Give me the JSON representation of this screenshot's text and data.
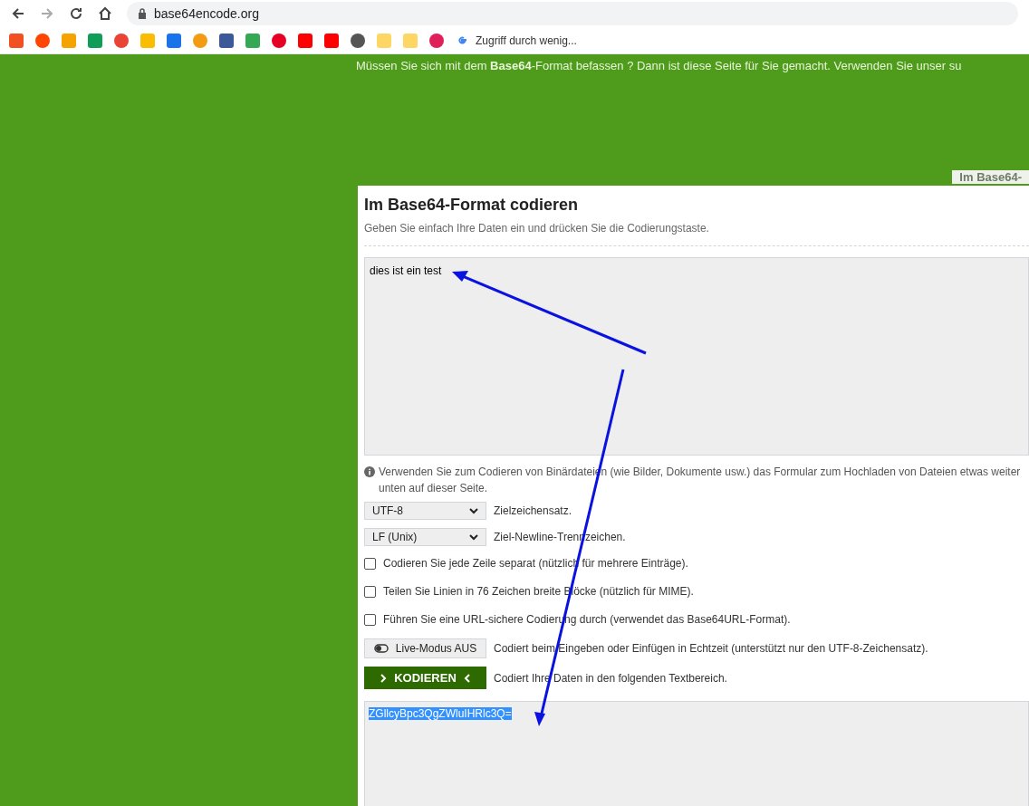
{
  "browser": {
    "url": "base64encode.org",
    "bookmarks": [
      {
        "color": "#f25022"
      },
      {
        "color": "#ff4500"
      },
      {
        "color": "#f4a300"
      },
      {
        "color": "#0f9d58"
      },
      {
        "color": "#ea4335"
      },
      {
        "color": "#fbbc04"
      },
      {
        "color": "#1a73e8"
      },
      {
        "color": "#f39c12"
      },
      {
        "color": "#3b5998"
      },
      {
        "color": "#34a853"
      },
      {
        "color": "#e60023"
      },
      {
        "color": "#ff0000"
      },
      {
        "color": "#ff0000"
      },
      {
        "color": "#555555"
      },
      {
        "color": "#fdd663"
      },
      {
        "color": "#fdd663"
      },
      {
        "color": "#e01e5a"
      }
    ],
    "bookmark_label": "Zugriff durch wenig..."
  },
  "header_text": "Müssen Sie sich mit dem **Base64**-Format befassen ? Dann ist diese Seite für Sie gemacht. Verwenden Sie unser su",
  "side_tab": "Im Base64-",
  "panel": {
    "title": "Im Base64-Format codieren",
    "subtitle": "Geben Sie einfach Ihre Daten ein und drücken Sie die Codierungstaste.",
    "input_value": "dies ist ein test",
    "info": "Verwenden Sie zum Codieren von Binärdateien (wie Bilder, Dokumente usw.) das Formular zum Hochladen von Dateien etwas weiter unten auf dieser Seite.",
    "selects": [
      {
        "value": "UTF-8",
        "label": "Zielzeichensatz."
      },
      {
        "value": "LF (Unix)",
        "label": "Ziel-Newline-Trennzeichen."
      }
    ],
    "options": [
      {
        "label": "Codieren Sie jede Zeile separat (nützlich für mehrere Einträge).",
        "checked": false
      },
      {
        "label": "Teilen Sie Linien in 76 Zeichen breite Blöcke (nützlich für MIME).",
        "checked": false
      },
      {
        "label": "Führen Sie eine URL-sichere Codierung durch (verwendet das Base64URL-Format).",
        "checked": false
      }
    ],
    "live_button": "Live-Modus AUS",
    "live_text": "Codiert beim Eingeben oder Einfügen in Echtzeit (unterstützt nur den UTF-8-Zeichensatz).",
    "encode_button": "KODIEREN",
    "encode_text": "Codiert Ihre Daten in den folgenden Textbereich.",
    "output_value": "ZGllcyBpc3QgZWluIHRlc3Q="
  }
}
